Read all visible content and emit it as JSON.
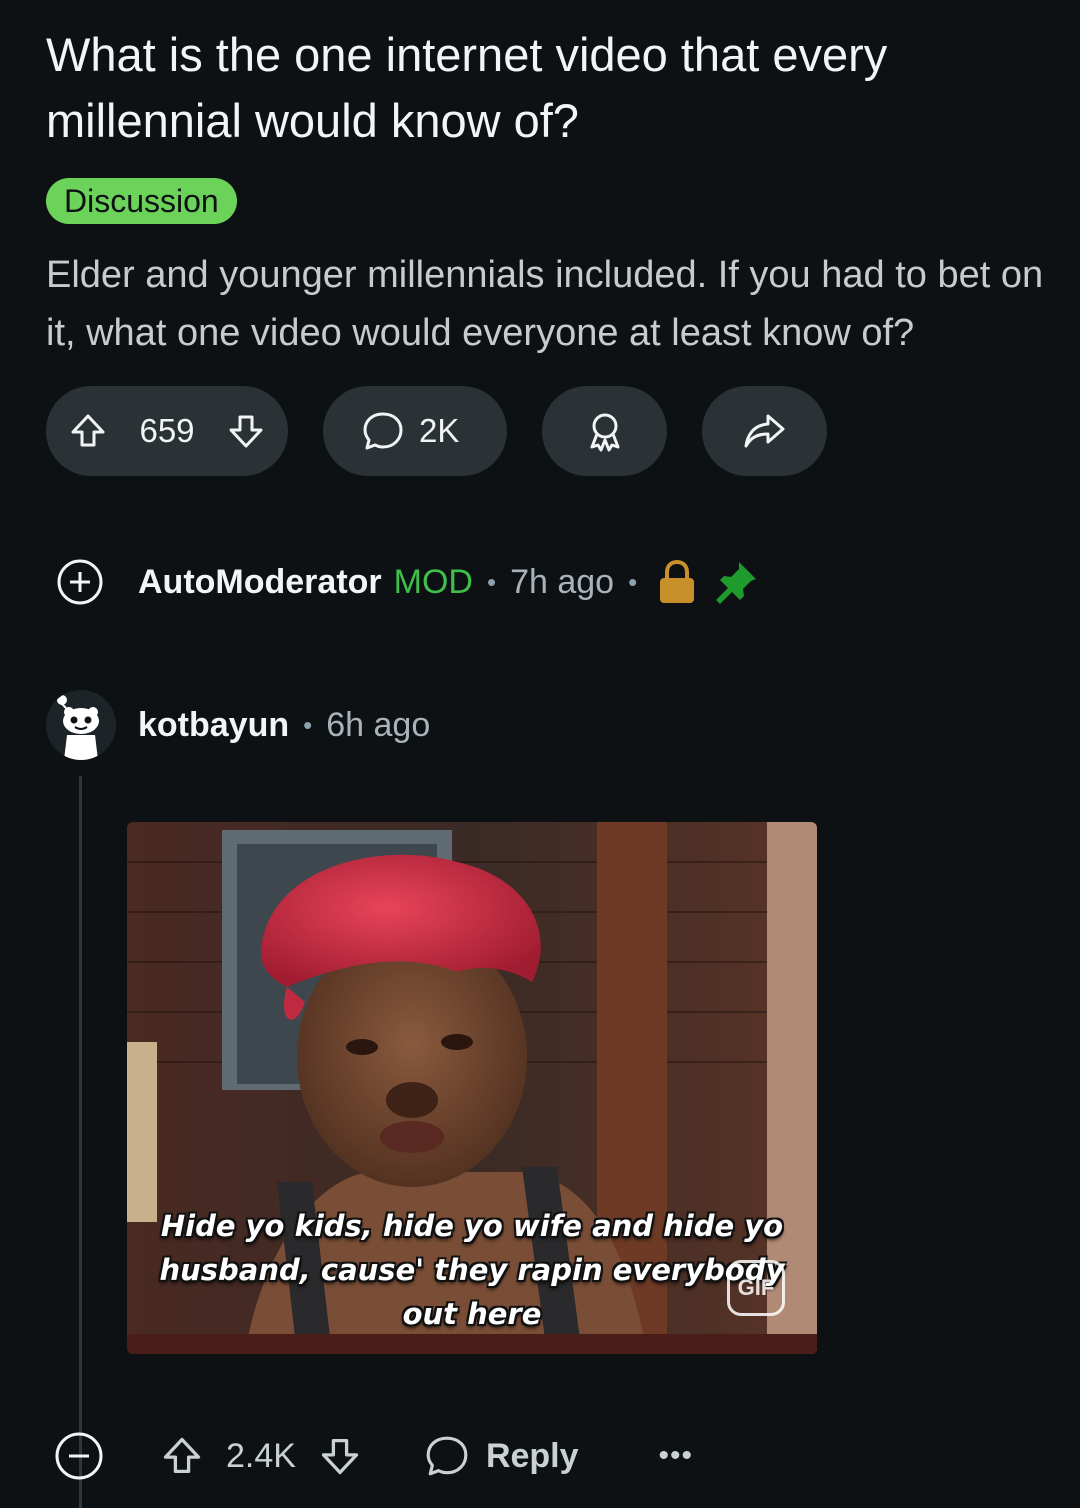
{
  "post": {
    "title": "What is the one internet video that every millennial would know of?",
    "flair": "Discussion",
    "body": "Elder and younger millennials included. If you had to bet on it, what one video would everyone at least know of?",
    "score": "659",
    "comment_count": "2K"
  },
  "mod_comment": {
    "author": "AutoModerator",
    "tag": "MOD",
    "separator": "•",
    "time": "7h ago",
    "icons": [
      "plus-icon",
      "lock-icon",
      "pin-icon"
    ]
  },
  "comment": {
    "author": "kotbayun",
    "separator": "•",
    "time": "6h ago",
    "gif_caption": "Hide yo kids, hide yo wife and hide yo husband, cause' they rapin everybody out here",
    "gif_badge": "GIF",
    "score": "2.4K",
    "reply_label": "Reply",
    "more_label": "•••"
  },
  "colors": {
    "background": "#0e1113",
    "pill": "#2a3236",
    "flair": "#6cd35a",
    "mod": "#3fbf4a",
    "lock": "#c8902a",
    "pin": "#1f9a2d"
  }
}
